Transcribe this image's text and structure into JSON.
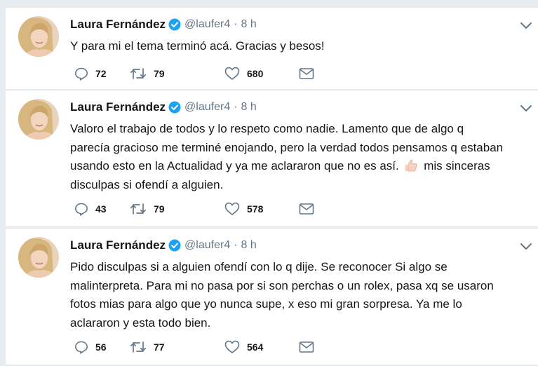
{
  "tweets": [
    {
      "author": "Laura Fernández",
      "handle": "@laufer4",
      "separator": "·",
      "time": "8 h",
      "lines": [
        "Y para mi el tema terminó acá. Gracias y besos!"
      ],
      "replies": "72",
      "retweets": "79",
      "likes": "680"
    },
    {
      "author": "Laura Fernández",
      "handle": "@laufer4",
      "separator": "·",
      "time": "8 h",
      "lines": [
        "Valoro el trabajo de todos y lo respeto como nadie. Lamento que de algo q",
        "parecía gracioso me terminé enojando, pero la verdad todos pensamos q estaban",
        "usando esto en la Actualidad y ya me aclararon que no es así.",
        "disculpas si ofendí a alguien."
      ],
      "line3_tail": "mis sinceras",
      "emoji": "thumbs-up-emoji",
      "replies": "43",
      "retweets": "79",
      "likes": "578"
    },
    {
      "author": "Laura Fernández",
      "handle": "@laufer4",
      "separator": "·",
      "time": "8 h",
      "lines": [
        "Pido disculpas si a alguien ofendí con lo q dije. Se reconocer Si algo se",
        "malinterpreta. Para mi no pasa por si son perchas o un rolex, pasa xq se usaron",
        "fotos mias para algo que yo nunca supe, x eso mi gran sorpresa. Ya me lo",
        "aclararon y esta todo bien."
      ],
      "replies": "56",
      "retweets": "77",
      "likes": "564"
    }
  ],
  "icons": {
    "reply": "reply-icon",
    "retweet": "retweet-icon",
    "like": "heart-icon",
    "dm": "envelope-icon",
    "verified": "verified-badge-icon",
    "menu": "chevron-down-icon"
  },
  "colors": {
    "background": "#e6ecf0",
    "card": "#ffffff",
    "text": "#14171a",
    "muted": "#657786",
    "verified": "#1da1f2"
  }
}
